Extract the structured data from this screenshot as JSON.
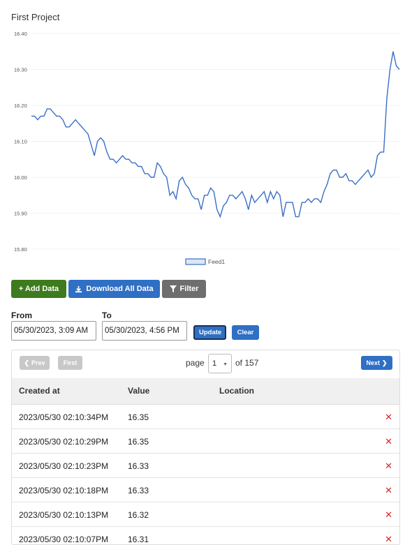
{
  "project": {
    "title": "First Project"
  },
  "chart_data": {
    "type": "line",
    "title": "",
    "xlabel": "",
    "ylabel": "",
    "ylim": [
      15.8,
      16.4
    ],
    "yticks": [
      "16.40",
      "16.30",
      "16.20",
      "16.10",
      "16.00",
      "15.90",
      "15.80"
    ],
    "grid": "horizontal",
    "legend_position": "bottom",
    "series": [
      {
        "name": "Feed1",
        "color": "#3a6fc4",
        "values": [
          16.17,
          16.17,
          16.16,
          16.17,
          16.17,
          16.19,
          16.19,
          16.18,
          16.17,
          16.17,
          16.16,
          16.14,
          16.14,
          16.15,
          16.16,
          16.15,
          16.14,
          16.13,
          16.12,
          16.09,
          16.06,
          16.1,
          16.11,
          16.1,
          16.07,
          16.05,
          16.05,
          16.04,
          16.05,
          16.06,
          16.05,
          16.05,
          16.04,
          16.04,
          16.03,
          16.03,
          16.01,
          16.01,
          16.0,
          16.0,
          16.04,
          16.03,
          16.01,
          16.0,
          15.95,
          15.96,
          15.94,
          15.99,
          16.0,
          15.98,
          15.97,
          15.95,
          15.94,
          15.94,
          15.91,
          15.95,
          15.95,
          15.97,
          15.96,
          15.91,
          15.89,
          15.92,
          15.93,
          15.95,
          15.95,
          15.94,
          15.95,
          15.96,
          15.94,
          15.91,
          15.95,
          15.93,
          15.94,
          15.95,
          15.96,
          15.93,
          15.96,
          15.94,
          15.96,
          15.95,
          15.89,
          15.93,
          15.93,
          15.93,
          15.89,
          15.89,
          15.93,
          15.93,
          15.94,
          15.93,
          15.94,
          15.94,
          15.93,
          15.96,
          15.98,
          16.01,
          16.02,
          16.02,
          16.0,
          16.0,
          16.01,
          15.99,
          15.99,
          15.98,
          15.99,
          16.0,
          16.01,
          16.02,
          16.0,
          16.01,
          16.06,
          16.07,
          16.07,
          16.22,
          16.3,
          16.35,
          16.31,
          16.3
        ]
      }
    ]
  },
  "toolbar": {
    "add_label": "+ Add Data",
    "download_label": "Download All Data",
    "filter_label": "Filter"
  },
  "filter": {
    "from_label": "From",
    "to_label": "To",
    "from_value": "05/30/2023, 3:09 AM",
    "to_value": "05/30/2023, 4:56 PM",
    "update_label": "Update",
    "clear_label": "Clear"
  },
  "pagination": {
    "prev_label": "Prev",
    "first_label": "First",
    "page_label": "page",
    "current_page": "1",
    "of_label": "of 157",
    "next_label": "Next"
  },
  "table": {
    "columns": [
      "Created at",
      "Value",
      "Location"
    ],
    "rows": [
      {
        "created": "2023/05/30 02:10:34PM",
        "value": "16.35",
        "location": ""
      },
      {
        "created": "2023/05/30 02:10:29PM",
        "value": "16.35",
        "location": ""
      },
      {
        "created": "2023/05/30 02:10:23PM",
        "value": "16.33",
        "location": ""
      },
      {
        "created": "2023/05/30 02:10:18PM",
        "value": "16.33",
        "location": ""
      },
      {
        "created": "2023/05/30 02:10:13PM",
        "value": "16.32",
        "location": ""
      },
      {
        "created": "2023/05/30 02:10:07PM",
        "value": "16.31",
        "location": ""
      }
    ]
  },
  "icons": {
    "delete": "close-icon",
    "download": "download-icon",
    "filter": "filter-icon",
    "prev": "chevron-left-icon",
    "next": "chevron-right-icon"
  }
}
